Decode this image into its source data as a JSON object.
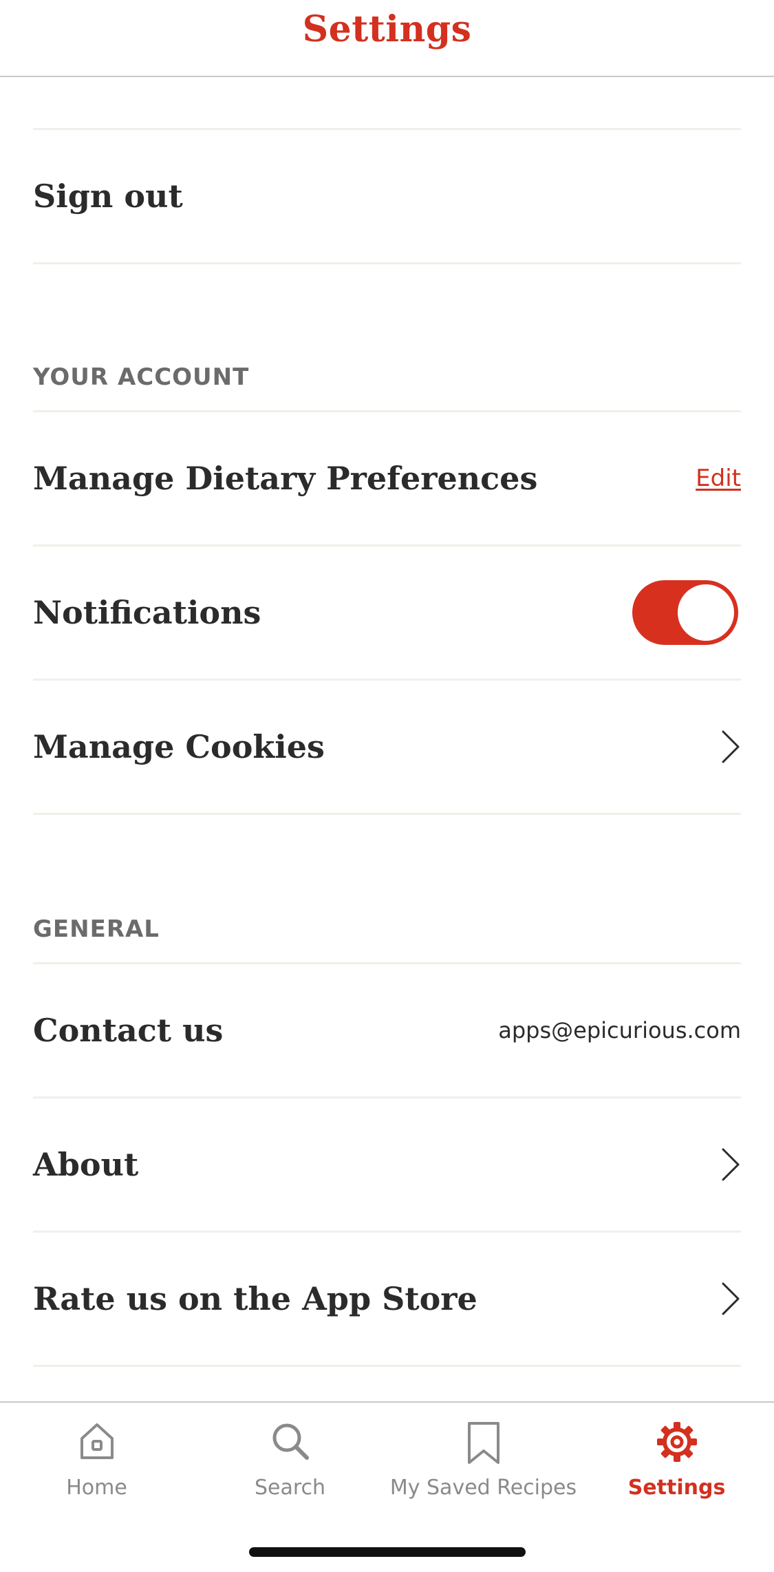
{
  "header": {
    "title": "Settings"
  },
  "rows": {
    "sign_out": "Sign out",
    "your_account_header": "YOUR ACCOUNT",
    "dietary": {
      "label": "Manage Dietary Preferences",
      "action": "Edit"
    },
    "notifications": {
      "label": "Notifications",
      "enabled": true
    },
    "cookies": {
      "label": "Manage Cookies"
    },
    "general_header": "GENERAL",
    "contact": {
      "label": "Contact us",
      "email": "apps@epicurious.com"
    },
    "about": {
      "label": "About"
    },
    "rate": {
      "label": "Rate us on the App Store"
    }
  },
  "tabs": [
    {
      "label": "Home",
      "icon": "home-icon",
      "active": false
    },
    {
      "label": "Search",
      "icon": "search-icon",
      "active": false
    },
    {
      "label": "My Saved Recipes",
      "icon": "bookmark-icon",
      "active": false
    },
    {
      "label": "Settings",
      "icon": "gear-icon",
      "active": true
    }
  ],
  "colors": {
    "accent": "#d3301f",
    "text": "#2b2b2b",
    "muted": "#6b6b6b",
    "divider": "#f1efe9"
  }
}
